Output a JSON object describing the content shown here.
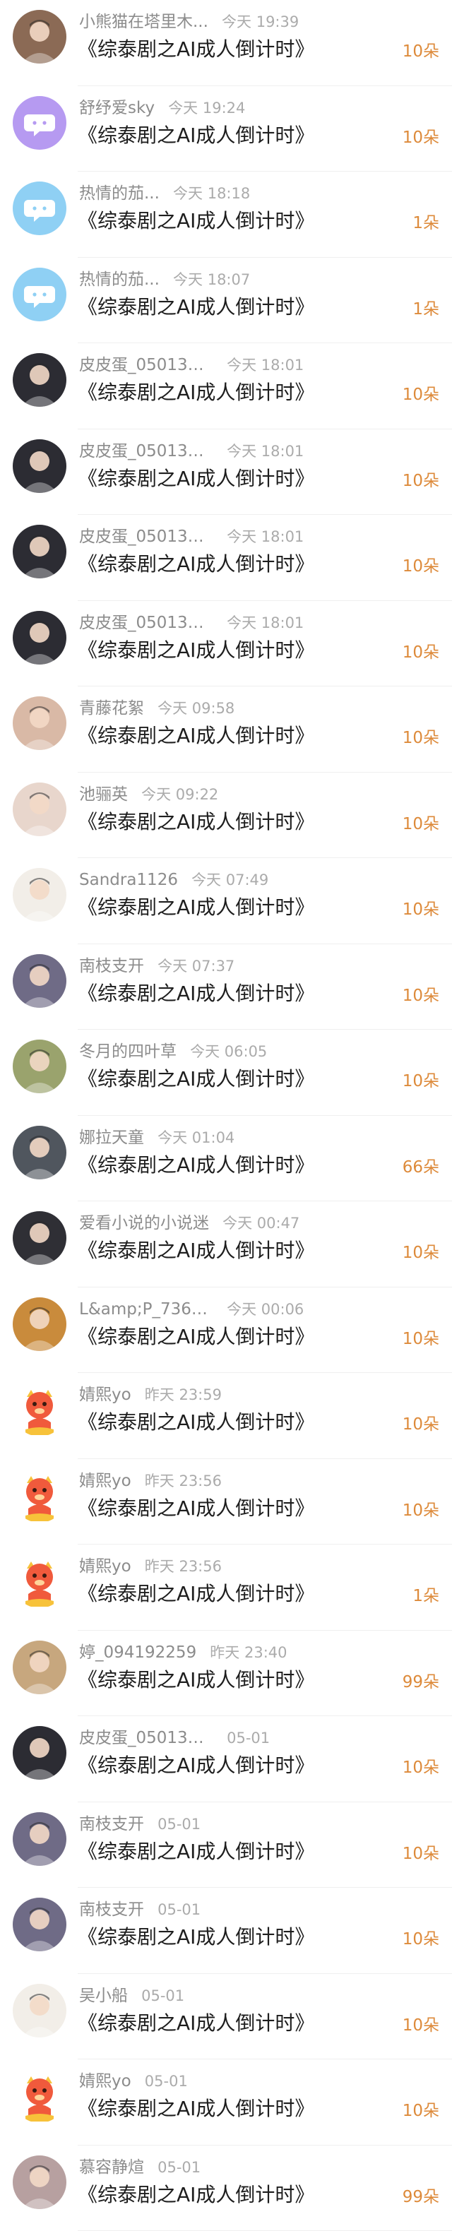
{
  "donations": [
    {
      "user": "小熊猫在塔里木...",
      "time": "今天 19:39",
      "title": "《综泰剧之AI成人倒计时》",
      "amount": "10朵",
      "avatar": "photo-avatar",
      "avatar_color": "#8b6a55"
    },
    {
      "user": "舒纾爱sky",
      "time": "今天 19:24",
      "title": "《综泰剧之AI成人倒计时》",
      "amount": "10朵",
      "avatar": "chat-bubble-icon",
      "avatar_color": "#b69af1"
    },
    {
      "user": "热情的茄...",
      "time": "今天 18:18",
      "title": "《综泰剧之AI成人倒计时》",
      "amount": "1朵",
      "avatar": "chat-bubble-icon",
      "avatar_color": "#8fd0f4"
    },
    {
      "user": "热情的茄...",
      "time": "今天 18:07",
      "title": "《综泰剧之AI成人倒计时》",
      "amount": "1朵",
      "avatar": "chat-bubble-icon",
      "avatar_color": "#8fd0f4"
    },
    {
      "user": "皮皮蛋_0501303...",
      "time": "今天 18:01",
      "title": "《综泰剧之AI成人倒计时》",
      "amount": "10朵",
      "avatar": "photo-avatar",
      "avatar_color": "#2c2c33"
    },
    {
      "user": "皮皮蛋_0501303...",
      "time": "今天 18:01",
      "title": "《综泰剧之AI成人倒计时》",
      "amount": "10朵",
      "avatar": "photo-avatar",
      "avatar_color": "#2c2c33"
    },
    {
      "user": "皮皮蛋_0501303...",
      "time": "今天 18:01",
      "title": "《综泰剧之AI成人倒计时》",
      "amount": "10朵",
      "avatar": "photo-avatar",
      "avatar_color": "#2c2c33"
    },
    {
      "user": "皮皮蛋_0501303...",
      "time": "今天 18:01",
      "title": "《综泰剧之AI成人倒计时》",
      "amount": "10朵",
      "avatar": "photo-avatar",
      "avatar_color": "#2c2c33"
    },
    {
      "user": "青藤花絮",
      "time": "今天 09:58",
      "title": "《综泰剧之AI成人倒计时》",
      "amount": "10朵",
      "avatar": "photo-avatar",
      "avatar_color": "#d9b9a6"
    },
    {
      "user": "池骊英",
      "time": "今天 09:22",
      "title": "《综泰剧之AI成人倒计时》",
      "amount": "10朵",
      "avatar": "photo-avatar",
      "avatar_color": "#e8d6cc"
    },
    {
      "user": "Sandra1126",
      "time": "今天 07:49",
      "title": "《综泰剧之AI成人倒计时》",
      "amount": "10朵",
      "avatar": "photo-avatar",
      "avatar_color": "#f2eee8"
    },
    {
      "user": "南枝支开",
      "time": "今天 07:37",
      "title": "《综泰剧之AI成人倒计时》",
      "amount": "10朵",
      "avatar": "photo-avatar",
      "avatar_color": "#6f6b86"
    },
    {
      "user": "冬月的四叶草",
      "time": "今天 06:05",
      "title": "《综泰剧之AI成人倒计时》",
      "amount": "10朵",
      "avatar": "photo-avatar",
      "avatar_color": "#9aa36d"
    },
    {
      "user": "娜拉天童",
      "time": "今天 01:04",
      "title": "《综泰剧之AI成人倒计时》",
      "amount": "66朵",
      "avatar": "photo-avatar",
      "avatar_color": "#50565e"
    },
    {
      "user": "爱看小说的小说迷",
      "time": "今天 00:47",
      "title": "《综泰剧之AI成人倒计时》",
      "amount": "10朵",
      "avatar": "photo-avatar",
      "avatar_color": "#2f2f35"
    },
    {
      "user": "L&amp;P_7365...",
      "time": "今天 00:06",
      "title": "《综泰剧之AI成人倒计时》",
      "amount": "10朵",
      "avatar": "photo-avatar",
      "avatar_color": "#c98b3c"
    },
    {
      "user": "婧熙yo",
      "time": "昨天 23:59",
      "title": "《综泰剧之AI成人倒计时》",
      "amount": "10朵",
      "avatar": "dragon-mascot-avatar",
      "avatar_color": "#f05a3c"
    },
    {
      "user": "婧熙yo",
      "time": "昨天 23:56",
      "title": "《综泰剧之AI成人倒计时》",
      "amount": "10朵",
      "avatar": "dragon-mascot-avatar",
      "avatar_color": "#f05a3c"
    },
    {
      "user": "婧熙yo",
      "time": "昨天 23:56",
      "title": "《综泰剧之AI成人倒计时》",
      "amount": "1朵",
      "avatar": "dragon-mascot-avatar",
      "avatar_color": "#f05a3c"
    },
    {
      "user": "婷_094192259",
      "time": "昨天 23:40",
      "title": "《综泰剧之AI成人倒计时》",
      "amount": "99朵",
      "avatar": "photo-avatar",
      "avatar_color": "#c7a77e"
    },
    {
      "user": "皮皮蛋_0501303...",
      "time": "05-01",
      "title": "《综泰剧之AI成人倒计时》",
      "amount": "10朵",
      "avatar": "photo-avatar",
      "avatar_color": "#2c2c33"
    },
    {
      "user": "南枝支开",
      "time": "05-01",
      "title": "《综泰剧之AI成人倒计时》",
      "amount": "10朵",
      "avatar": "photo-avatar",
      "avatar_color": "#6f6b86"
    },
    {
      "user": "南枝支开",
      "time": "05-01",
      "title": "《综泰剧之AI成人倒计时》",
      "amount": "10朵",
      "avatar": "photo-avatar",
      "avatar_color": "#6f6b86"
    },
    {
      "user": "吴小船",
      "time": "05-01",
      "title": "《综泰剧之AI成人倒计时》",
      "amount": "10朵",
      "avatar": "photo-avatar",
      "avatar_color": "#f2eee8"
    },
    {
      "user": "婧熙yo",
      "time": "05-01",
      "title": "《综泰剧之AI成人倒计时》",
      "amount": "10朵",
      "avatar": "dragon-mascot-avatar",
      "avatar_color": "#f05a3c"
    },
    {
      "user": "慕容静煊",
      "time": "05-01",
      "title": "《综泰剧之AI成人倒计时》",
      "amount": "99朵",
      "avatar": "photo-avatar",
      "avatar_color": "#b7a0a0"
    }
  ]
}
